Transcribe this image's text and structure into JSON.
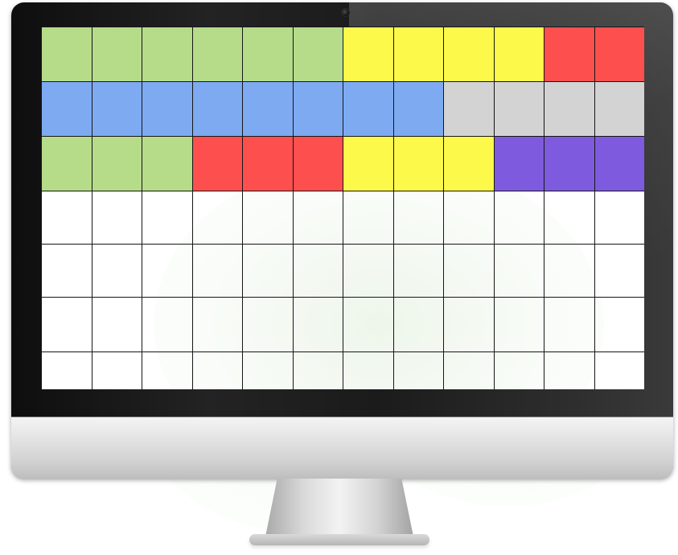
{
  "grid": {
    "columns": 12,
    "rows": 7,
    "colors": {
      "green": "#b6dc8a",
      "yellow": "#fcf94a",
      "red": "#fe4f4f",
      "blue": "#7eaaf2",
      "gray": "#d3d3d3",
      "purple": "#7e5bde",
      "white": "#ffffff"
    },
    "filled_rows": [
      [
        "green",
        "green",
        "green",
        "green",
        "green",
        "green",
        "yellow",
        "yellow",
        "yellow",
        "yellow",
        "red",
        "red"
      ],
      [
        "blue",
        "blue",
        "blue",
        "blue",
        "blue",
        "blue",
        "blue",
        "blue",
        "gray",
        "gray",
        "gray",
        "gray"
      ],
      [
        "green",
        "green",
        "green",
        "red",
        "red",
        "red",
        "yellow",
        "yellow",
        "yellow",
        "purple",
        "purple",
        "purple"
      ],
      [
        "white",
        "white",
        "white",
        "white",
        "white",
        "white",
        "white",
        "white",
        "white",
        "white",
        "white",
        "white"
      ],
      [
        "white",
        "white",
        "white",
        "white",
        "white",
        "white",
        "white",
        "white",
        "white",
        "white",
        "white",
        "white"
      ],
      [
        "white",
        "white",
        "white",
        "white",
        "white",
        "white",
        "white",
        "white",
        "white",
        "white",
        "white",
        "white"
      ],
      [
        "white",
        "white",
        "white",
        "white",
        "white",
        "white",
        "white",
        "white",
        "white",
        "white",
        "white",
        "white"
      ]
    ]
  }
}
